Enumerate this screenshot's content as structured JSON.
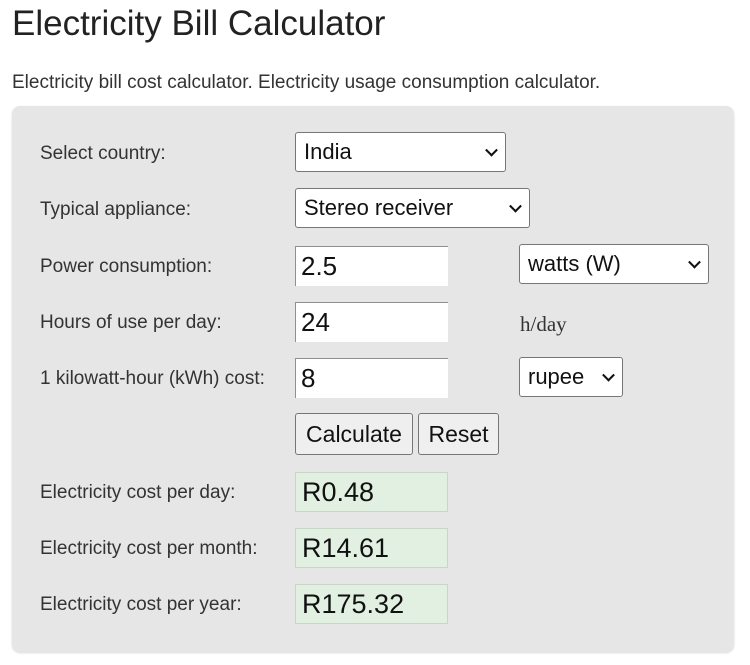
{
  "page": {
    "title": "Electricity Bill Calculator",
    "subtitle": "Electricity bill cost calculator. Electricity usage consumption calculator."
  },
  "form": {
    "country": {
      "label": "Select country:",
      "value": "India"
    },
    "appliance": {
      "label": "Typical appliance:",
      "value": "Stereo receiver"
    },
    "power": {
      "label": "Power consumption:",
      "value": "2.5",
      "unit": "watts (W)"
    },
    "hours": {
      "label": "Hours of use per day:",
      "value": "24",
      "unit": "h/day"
    },
    "cost": {
      "label": "1 kilowatt-hour (kWh) cost:",
      "value": "8",
      "currency": "rupee"
    },
    "buttons": {
      "calculate": "Calculate",
      "reset": "Reset"
    }
  },
  "results": {
    "day": {
      "label": "Electricity cost per day:",
      "value": "R0.48"
    },
    "month": {
      "label": "Electricity cost per month:",
      "value": "R14.61"
    },
    "year": {
      "label": "Electricity cost per year:",
      "value": "R175.32"
    }
  }
}
